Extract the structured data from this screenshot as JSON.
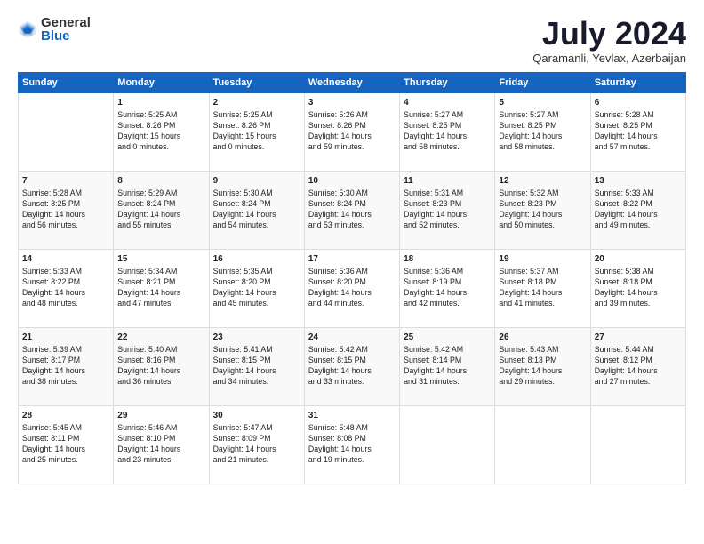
{
  "logo": {
    "general": "General",
    "blue": "Blue"
  },
  "header": {
    "month": "July 2024",
    "location": "Qaramanli, Yevlax, Azerbaijan"
  },
  "columns": [
    "Sunday",
    "Monday",
    "Tuesday",
    "Wednesday",
    "Thursday",
    "Friday",
    "Saturday"
  ],
  "weeks": [
    [
      {
        "day": "",
        "info": ""
      },
      {
        "day": "1",
        "info": "Sunrise: 5:25 AM\nSunset: 8:26 PM\nDaylight: 15 hours\nand 0 minutes."
      },
      {
        "day": "2",
        "info": "Sunrise: 5:25 AM\nSunset: 8:26 PM\nDaylight: 15 hours\nand 0 minutes."
      },
      {
        "day": "3",
        "info": "Sunrise: 5:26 AM\nSunset: 8:26 PM\nDaylight: 14 hours\nand 59 minutes."
      },
      {
        "day": "4",
        "info": "Sunrise: 5:27 AM\nSunset: 8:25 PM\nDaylight: 14 hours\nand 58 minutes."
      },
      {
        "day": "5",
        "info": "Sunrise: 5:27 AM\nSunset: 8:25 PM\nDaylight: 14 hours\nand 58 minutes."
      },
      {
        "day": "6",
        "info": "Sunrise: 5:28 AM\nSunset: 8:25 PM\nDaylight: 14 hours\nand 57 minutes."
      }
    ],
    [
      {
        "day": "7",
        "info": "Sunrise: 5:28 AM\nSunset: 8:25 PM\nDaylight: 14 hours\nand 56 minutes."
      },
      {
        "day": "8",
        "info": "Sunrise: 5:29 AM\nSunset: 8:24 PM\nDaylight: 14 hours\nand 55 minutes."
      },
      {
        "day": "9",
        "info": "Sunrise: 5:30 AM\nSunset: 8:24 PM\nDaylight: 14 hours\nand 54 minutes."
      },
      {
        "day": "10",
        "info": "Sunrise: 5:30 AM\nSunset: 8:24 PM\nDaylight: 14 hours\nand 53 minutes."
      },
      {
        "day": "11",
        "info": "Sunrise: 5:31 AM\nSunset: 8:23 PM\nDaylight: 14 hours\nand 52 minutes."
      },
      {
        "day": "12",
        "info": "Sunrise: 5:32 AM\nSunset: 8:23 PM\nDaylight: 14 hours\nand 50 minutes."
      },
      {
        "day": "13",
        "info": "Sunrise: 5:33 AM\nSunset: 8:22 PM\nDaylight: 14 hours\nand 49 minutes."
      }
    ],
    [
      {
        "day": "14",
        "info": "Sunrise: 5:33 AM\nSunset: 8:22 PM\nDaylight: 14 hours\nand 48 minutes."
      },
      {
        "day": "15",
        "info": "Sunrise: 5:34 AM\nSunset: 8:21 PM\nDaylight: 14 hours\nand 47 minutes."
      },
      {
        "day": "16",
        "info": "Sunrise: 5:35 AM\nSunset: 8:20 PM\nDaylight: 14 hours\nand 45 minutes."
      },
      {
        "day": "17",
        "info": "Sunrise: 5:36 AM\nSunset: 8:20 PM\nDaylight: 14 hours\nand 44 minutes."
      },
      {
        "day": "18",
        "info": "Sunrise: 5:36 AM\nSunset: 8:19 PM\nDaylight: 14 hours\nand 42 minutes."
      },
      {
        "day": "19",
        "info": "Sunrise: 5:37 AM\nSunset: 8:18 PM\nDaylight: 14 hours\nand 41 minutes."
      },
      {
        "day": "20",
        "info": "Sunrise: 5:38 AM\nSunset: 8:18 PM\nDaylight: 14 hours\nand 39 minutes."
      }
    ],
    [
      {
        "day": "21",
        "info": "Sunrise: 5:39 AM\nSunset: 8:17 PM\nDaylight: 14 hours\nand 38 minutes."
      },
      {
        "day": "22",
        "info": "Sunrise: 5:40 AM\nSunset: 8:16 PM\nDaylight: 14 hours\nand 36 minutes."
      },
      {
        "day": "23",
        "info": "Sunrise: 5:41 AM\nSunset: 8:15 PM\nDaylight: 14 hours\nand 34 minutes."
      },
      {
        "day": "24",
        "info": "Sunrise: 5:42 AM\nSunset: 8:15 PM\nDaylight: 14 hours\nand 33 minutes."
      },
      {
        "day": "25",
        "info": "Sunrise: 5:42 AM\nSunset: 8:14 PM\nDaylight: 14 hours\nand 31 minutes."
      },
      {
        "day": "26",
        "info": "Sunrise: 5:43 AM\nSunset: 8:13 PM\nDaylight: 14 hours\nand 29 minutes."
      },
      {
        "day": "27",
        "info": "Sunrise: 5:44 AM\nSunset: 8:12 PM\nDaylight: 14 hours\nand 27 minutes."
      }
    ],
    [
      {
        "day": "28",
        "info": "Sunrise: 5:45 AM\nSunset: 8:11 PM\nDaylight: 14 hours\nand 25 minutes."
      },
      {
        "day": "29",
        "info": "Sunrise: 5:46 AM\nSunset: 8:10 PM\nDaylight: 14 hours\nand 23 minutes."
      },
      {
        "day": "30",
        "info": "Sunrise: 5:47 AM\nSunset: 8:09 PM\nDaylight: 14 hours\nand 21 minutes."
      },
      {
        "day": "31",
        "info": "Sunrise: 5:48 AM\nSunset: 8:08 PM\nDaylight: 14 hours\nand 19 minutes."
      },
      {
        "day": "",
        "info": ""
      },
      {
        "day": "",
        "info": ""
      },
      {
        "day": "",
        "info": ""
      }
    ]
  ]
}
